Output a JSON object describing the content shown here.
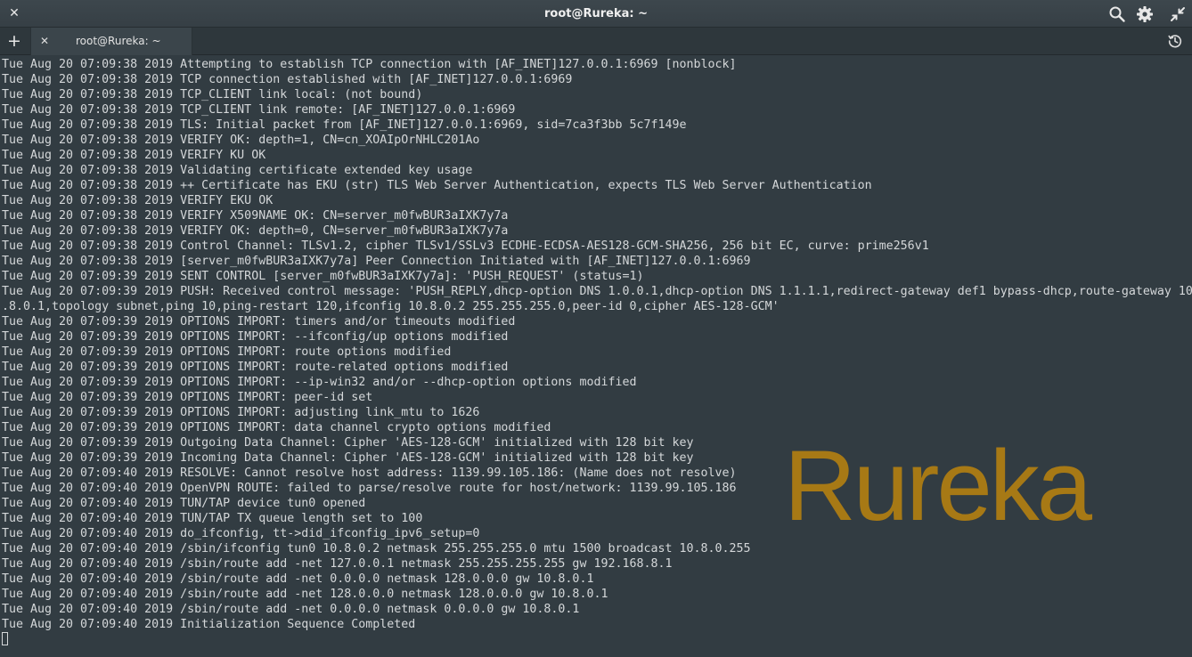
{
  "window": {
    "title": "root@Rureka: ~",
    "close_icon": "close-icon",
    "search_icon": "search-icon",
    "settings_icon": "gear-icon",
    "restore_icon": "restore-icon"
  },
  "tabs": {
    "add_icon": "plus-icon",
    "items": [
      {
        "label": "root@Rureka: ~",
        "close_icon": "close-icon",
        "active": true
      }
    ],
    "history_icon": "history-icon"
  },
  "watermark": {
    "text": "Rureka",
    "color": "#b17f12"
  },
  "terminal": {
    "lines": [
      "Tue Aug 20 07:09:38 2019 Attempting to establish TCP connection with [AF_INET]127.0.0.1:6969 [nonblock]",
      "Tue Aug 20 07:09:38 2019 TCP connection established with [AF_INET]127.0.0.1:6969",
      "Tue Aug 20 07:09:38 2019 TCP_CLIENT link local: (not bound)",
      "Tue Aug 20 07:09:38 2019 TCP_CLIENT link remote: [AF_INET]127.0.0.1:6969",
      "Tue Aug 20 07:09:38 2019 TLS: Initial packet from [AF_INET]127.0.0.1:6969, sid=7ca3f3bb 5c7f149e",
      "Tue Aug 20 07:09:38 2019 VERIFY OK: depth=1, CN=cn_XOAIpOrNHLC201Ao",
      "Tue Aug 20 07:09:38 2019 VERIFY KU OK",
      "Tue Aug 20 07:09:38 2019 Validating certificate extended key usage",
      "Tue Aug 20 07:09:38 2019 ++ Certificate has EKU (str) TLS Web Server Authentication, expects TLS Web Server Authentication",
      "Tue Aug 20 07:09:38 2019 VERIFY EKU OK",
      "Tue Aug 20 07:09:38 2019 VERIFY X509NAME OK: CN=server_m0fwBUR3aIXK7y7a",
      "Tue Aug 20 07:09:38 2019 VERIFY OK: depth=0, CN=server_m0fwBUR3aIXK7y7a",
      "Tue Aug 20 07:09:38 2019 Control Channel: TLSv1.2, cipher TLSv1/SSLv3 ECDHE-ECDSA-AES128-GCM-SHA256, 256 bit EC, curve: prime256v1",
      "Tue Aug 20 07:09:38 2019 [server_m0fwBUR3aIXK7y7a] Peer Connection Initiated with [AF_INET]127.0.0.1:6969",
      "Tue Aug 20 07:09:39 2019 SENT CONTROL [server_m0fwBUR3aIXK7y7a]: 'PUSH_REQUEST' (status=1)",
      "Tue Aug 20 07:09:39 2019 PUSH: Received control message: 'PUSH_REPLY,dhcp-option DNS 1.0.0.1,dhcp-option DNS 1.1.1.1,redirect-gateway def1 bypass-dhcp,route-gateway 10",
      ".8.0.1,topology subnet,ping 10,ping-restart 120,ifconfig 10.8.0.2 255.255.255.0,peer-id 0,cipher AES-128-GCM'",
      "Tue Aug 20 07:09:39 2019 OPTIONS IMPORT: timers and/or timeouts modified",
      "Tue Aug 20 07:09:39 2019 OPTIONS IMPORT: --ifconfig/up options modified",
      "Tue Aug 20 07:09:39 2019 OPTIONS IMPORT: route options modified",
      "Tue Aug 20 07:09:39 2019 OPTIONS IMPORT: route-related options modified",
      "Tue Aug 20 07:09:39 2019 OPTIONS IMPORT: --ip-win32 and/or --dhcp-option options modified",
      "Tue Aug 20 07:09:39 2019 OPTIONS IMPORT: peer-id set",
      "Tue Aug 20 07:09:39 2019 OPTIONS IMPORT: adjusting link_mtu to 1626",
      "Tue Aug 20 07:09:39 2019 OPTIONS IMPORT: data channel crypto options modified",
      "Tue Aug 20 07:09:39 2019 Outgoing Data Channel: Cipher 'AES-128-GCM' initialized with 128 bit key",
      "Tue Aug 20 07:09:39 2019 Incoming Data Channel: Cipher 'AES-128-GCM' initialized with 128 bit key",
      "Tue Aug 20 07:09:40 2019 RESOLVE: Cannot resolve host address: 1139.99.105.186: (Name does not resolve)",
      "Tue Aug 20 07:09:40 2019 OpenVPN ROUTE: failed to parse/resolve route for host/network: 1139.99.105.186",
      "Tue Aug 20 07:09:40 2019 TUN/TAP device tun0 opened",
      "Tue Aug 20 07:09:40 2019 TUN/TAP TX queue length set to 100",
      "Tue Aug 20 07:09:40 2019 do_ifconfig, tt->did_ifconfig_ipv6_setup=0",
      "Tue Aug 20 07:09:40 2019 /sbin/ifconfig tun0 10.8.0.2 netmask 255.255.255.0 mtu 1500 broadcast 10.8.0.255",
      "Tue Aug 20 07:09:40 2019 /sbin/route add -net 127.0.0.1 netmask 255.255.255.255 gw 192.168.8.1",
      "Tue Aug 20 07:09:40 2019 /sbin/route add -net 0.0.0.0 netmask 128.0.0.0 gw 10.8.0.1",
      "Tue Aug 20 07:09:40 2019 /sbin/route add -net 128.0.0.0 netmask 128.0.0.0 gw 10.8.0.1",
      "Tue Aug 20 07:09:40 2019 /sbin/route add -net 0.0.0.0 netmask 0.0.0.0 gw 10.8.0.1",
      "Tue Aug 20 07:09:40 2019 Initialization Sequence Completed"
    ]
  }
}
